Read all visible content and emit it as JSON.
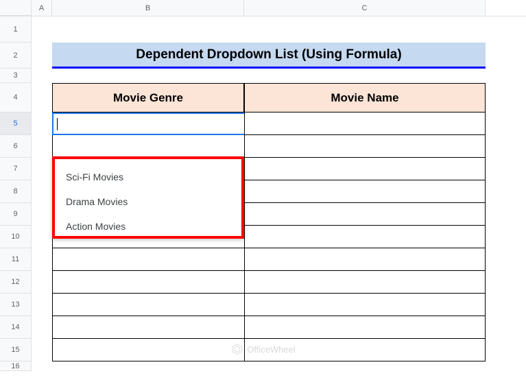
{
  "columns": [
    "",
    "A",
    "B",
    "C"
  ],
  "rows": [
    "1",
    "2",
    "3",
    "4",
    "5",
    "6",
    "7",
    "8",
    "9",
    "10",
    "11",
    "12",
    "13",
    "14",
    "15",
    "16"
  ],
  "title": "Dependent Dropdown List (Using Formula)",
  "headers": {
    "genre": "Movie Genre",
    "name": "Movie Name"
  },
  "dropdown": {
    "items": [
      "Sci-Fi Movies",
      "Drama Movies",
      "Action Movies"
    ]
  },
  "activeRow": "5",
  "watermark": "OfficeWheel"
}
